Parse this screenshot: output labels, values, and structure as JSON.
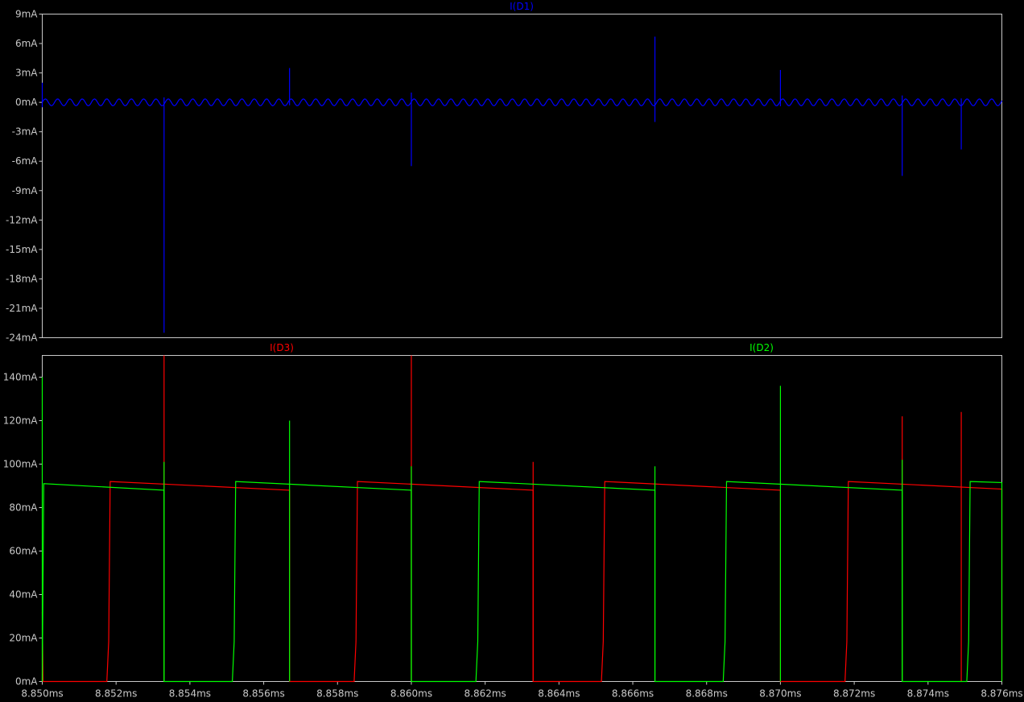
{
  "chart_data": [
    {
      "type": "line",
      "title": "I(D1)",
      "xlabel": "",
      "ylabel": "",
      "xlim": [
        8.85,
        8.876
      ],
      "ylim": [
        -24,
        9
      ],
      "x_unit": "ms",
      "y_unit": "mA",
      "grid": false,
      "y_ticks": [
        "9mA",
        "6mA",
        "3mA",
        "0mA",
        "-3mA",
        "-6mA",
        "-9mA",
        "-12mA",
        "-15mA",
        "-18mA",
        "-21mA",
        "-24mA"
      ],
      "y_tick_values": [
        9,
        6,
        3,
        0,
        -3,
        -6,
        -9,
        -12,
        -15,
        -18,
        -21,
        -24
      ],
      "series": [
        {
          "name": "I(D1)",
          "color": "#0000ff",
          "baseline": 0,
          "ripple_amplitude": 0.35,
          "ripple_period_ms": 0.000333,
          "spikes": [
            {
              "x": 8.85,
              "min": -0.5,
              "max": 2.0
            },
            {
              "x": 8.8533,
              "min": -23.5,
              "max": 0.5
            },
            {
              "x": 8.8567,
              "min": -0.3,
              "max": 3.5
            },
            {
              "x": 8.86,
              "min": -6.5,
              "max": 1.0
            },
            {
              "x": 8.8666,
              "min": -2.0,
              "max": 6.7
            },
            {
              "x": 8.87,
              "min": -0.4,
              "max": 3.3
            },
            {
              "x": 8.8733,
              "min": -7.5,
              "max": 0.7
            },
            {
              "x": 8.8749,
              "min": -4.8,
              "max": 0.4
            }
          ]
        }
      ]
    },
    {
      "type": "line",
      "title": "",
      "xlabel": "",
      "ylabel": "",
      "xlim": [
        8.85,
        8.876
      ],
      "ylim": [
        0,
        150
      ],
      "x_unit": "ms",
      "y_unit": "mA",
      "grid": false,
      "x_ticks": [
        "8.850ms",
        "8.852ms",
        "8.854ms",
        "8.856ms",
        "8.858ms",
        "8.860ms",
        "8.862ms",
        "8.864ms",
        "8.866ms",
        "8.868ms",
        "8.870ms",
        "8.872ms",
        "8.874ms",
        "8.876ms"
      ],
      "x_tick_values": [
        8.85,
        8.852,
        8.854,
        8.856,
        8.858,
        8.86,
        8.862,
        8.864,
        8.866,
        8.868,
        8.87,
        8.872,
        8.874,
        8.876
      ],
      "y_ticks": [
        "140mA",
        "120mA",
        "100mA",
        "80mA",
        "60mA",
        "40mA",
        "20mA",
        "0mA"
      ],
      "y_tick_values": [
        140,
        120,
        100,
        80,
        60,
        40,
        20,
        0
      ],
      "series": [
        {
          "name": "I(D3)",
          "color": "#ff0000",
          "on_intervals": [
            {
              "start": 8.8518,
              "end": 8.8567,
              "y_start": 92,
              "y_end": 88
            },
            {
              "start": 8.8585,
              "end": 8.8633,
              "y_start": 92,
              "y_end": 88
            },
            {
              "start": 8.8652,
              "end": 8.87,
              "y_start": 92,
              "y_end": 88
            },
            {
              "start": 8.8718,
              "end": 8.876,
              "y_start": 92,
              "y_end": 88.5
            }
          ],
          "pre_trace": {
            "x": 8.85,
            "y": 32
          },
          "spikes": [
            {
              "x": 8.8533,
              "max": 150
            },
            {
              "x": 8.86,
              "max": 150
            },
            {
              "x": 8.8633,
              "max": 101
            },
            {
              "x": 8.8733,
              "max": 122
            },
            {
              "x": 8.8749,
              "max": 124
            }
          ]
        },
        {
          "name": "I(D2)",
          "color": "#00ff00",
          "on_intervals": [
            {
              "start": 8.85,
              "end": 8.8533,
              "y_start": 91,
              "y_end": 88
            },
            {
              "start": 8.8552,
              "end": 8.86,
              "y_start": 92,
              "y_end": 88
            },
            {
              "start": 8.8618,
              "end": 8.8666,
              "y_start": 92,
              "y_end": 88
            },
            {
              "start": 8.8685,
              "end": 8.8733,
              "y_start": 92,
              "y_end": 88
            },
            {
              "start": 8.8751,
              "end": 8.876,
              "y_start": 92,
              "y_end": 91.5
            }
          ],
          "spikes": [
            {
              "x": 8.85,
              "max": 140
            },
            {
              "x": 8.8533,
              "max": 101
            },
            {
              "x": 8.8567,
              "max": 120
            },
            {
              "x": 8.86,
              "max": 99
            },
            {
              "x": 8.8666,
              "max": 99
            },
            {
              "x": 8.87,
              "max": 136
            },
            {
              "x": 8.8733,
              "max": 102
            }
          ]
        }
      ]
    }
  ]
}
